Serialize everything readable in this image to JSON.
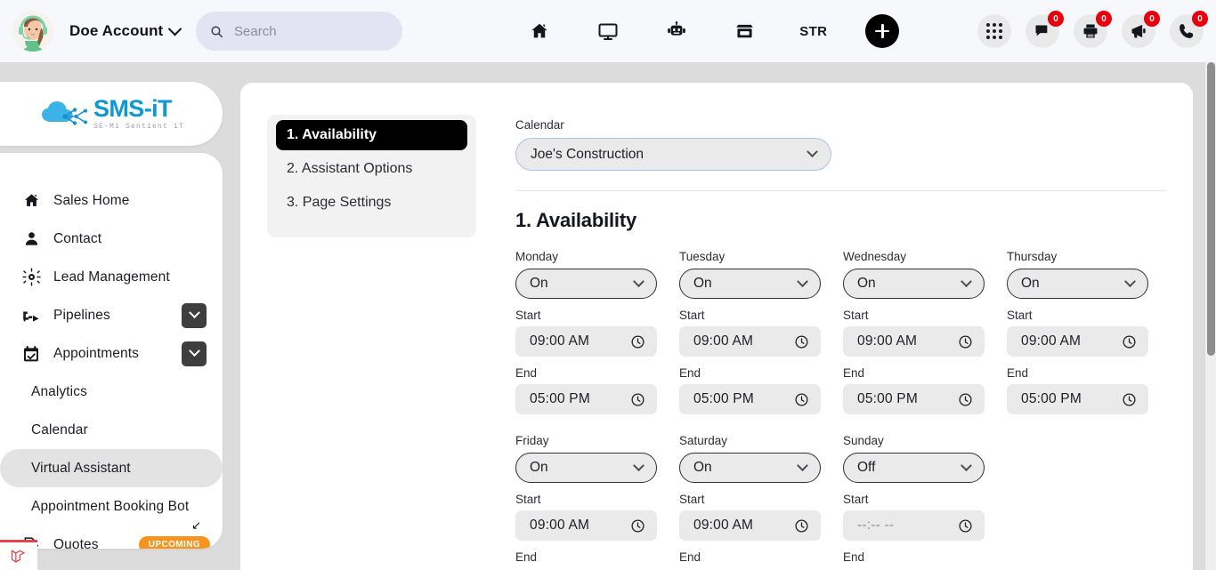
{
  "topbar": {
    "account_name": "Doe Account",
    "search_placeholder": "Search",
    "search_value": "",
    "nav_items": [
      {
        "name": "home-icon",
        "label": ""
      },
      {
        "name": "monitor-icon",
        "label": ""
      },
      {
        "name": "robot-icon",
        "label": ""
      },
      {
        "name": "storefront-icon",
        "label": ""
      },
      {
        "name": "str-label",
        "label": "STR"
      }
    ],
    "str_label": "STR",
    "add_button_label": "+",
    "right_icons": [
      {
        "name": "apps-grid-icon",
        "badge": null
      },
      {
        "name": "chat-icon",
        "badge": "0"
      },
      {
        "name": "printer-icon",
        "badge": "0"
      },
      {
        "name": "megaphone-icon",
        "badge": "0"
      },
      {
        "name": "phone-icon",
        "badge": "0"
      }
    ]
  },
  "brand": {
    "name": "SMS-iT",
    "tagline": "SE-Mi Sentient iT"
  },
  "sidebar": {
    "items": [
      {
        "label": "Sales Home",
        "icon": "home-icon",
        "type": "top",
        "expander": false,
        "active": false
      },
      {
        "label": "Contact",
        "icon": "user-icon",
        "type": "top",
        "expander": false,
        "active": false
      },
      {
        "label": "Lead Management",
        "icon": "lead-icon",
        "type": "top",
        "expander": false,
        "active": false
      },
      {
        "label": "Pipelines",
        "icon": "pipeline-icon",
        "type": "top",
        "expander": true,
        "active": false
      },
      {
        "label": "Appointments",
        "icon": "calendar-check-icon",
        "type": "top",
        "expander": true,
        "active": false
      },
      {
        "label": "Analytics",
        "icon": "",
        "type": "sub",
        "expander": false,
        "active": false
      },
      {
        "label": "Calendar",
        "icon": "",
        "type": "sub",
        "expander": false,
        "active": false
      },
      {
        "label": "Virtual Assistant",
        "icon": "",
        "type": "sub",
        "expander": false,
        "active": true
      },
      {
        "label": "Appointment Booking Bot",
        "icon": "",
        "type": "sub",
        "expander": false,
        "active": false
      },
      {
        "label": "Quotes",
        "icon": "quote-doc-icon",
        "type": "top",
        "expander": false,
        "active": false,
        "badge": "UPCOMING"
      }
    ],
    "upcoming_badge": "UPCOMING"
  },
  "main": {
    "tabs": [
      {
        "label": "1. Availability",
        "active": true
      },
      {
        "label": "2. Assistant Options",
        "active": false
      },
      {
        "label": "3. Page Settings",
        "active": false
      }
    ],
    "calendar_field_label": "Calendar",
    "calendar_value": "Joe's Construction",
    "section_title": "1. Availability",
    "start_label": "Start",
    "end_label": "End",
    "days": [
      {
        "name": "Monday",
        "state": "On",
        "start": "09:00 AM",
        "end": "05:00 PM"
      },
      {
        "name": "Tuesday",
        "state": "On",
        "start": "09:00 AM",
        "end": "05:00 PM"
      },
      {
        "name": "Wednesday",
        "state": "On",
        "start": "09:00 AM",
        "end": "05:00 PM"
      },
      {
        "name": "Thursday",
        "state": "On",
        "start": "09:00 AM",
        "end": "05:00 PM"
      },
      {
        "name": "Friday",
        "state": "On",
        "start": "09:00 AM",
        "end": ""
      },
      {
        "name": "Saturday",
        "state": "On",
        "start": "09:00 AM",
        "end": ""
      },
      {
        "name": "Sunday",
        "state": "Off",
        "start": "--:-- --",
        "end": ""
      }
    ]
  },
  "colors": {
    "accent_black": "#000000",
    "brand_blue": "#0d99d6",
    "badge_red": "#e8000d",
    "upcoming_orange": "#f7941d",
    "laravel_red": "#e5424a",
    "search_lilac": "#e2e3f3"
  }
}
